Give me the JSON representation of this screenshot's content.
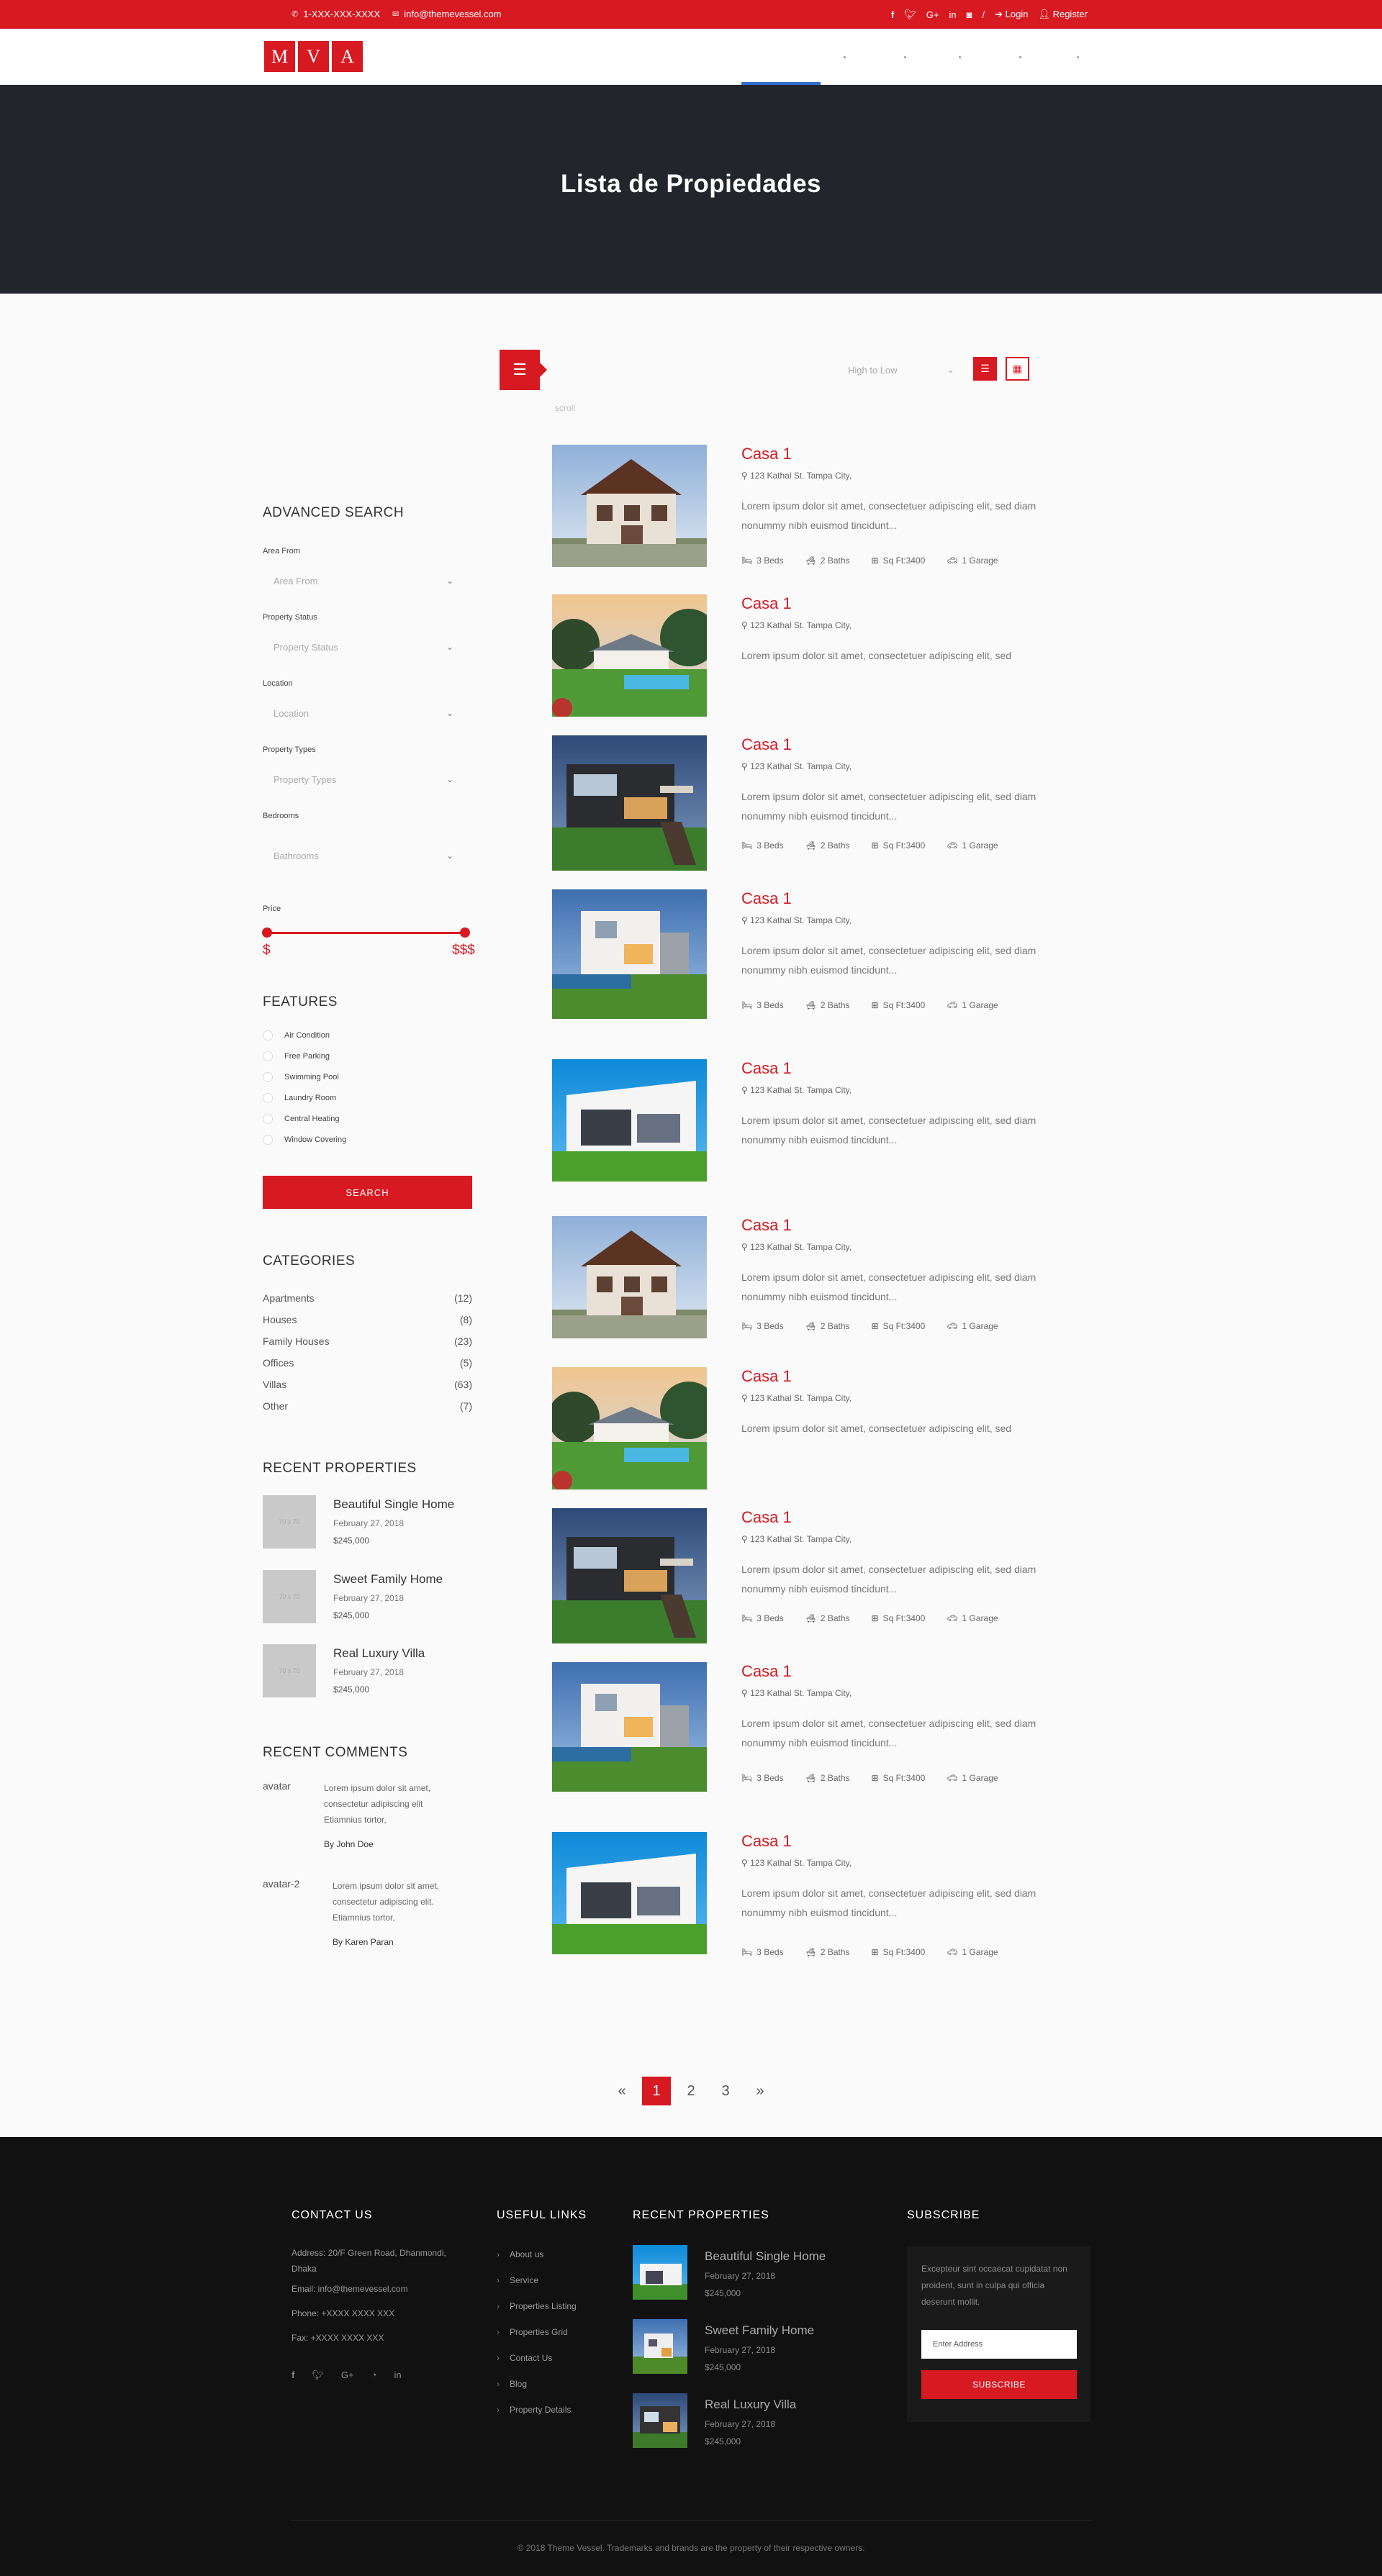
{
  "topbar": {
    "phone": "1-XXX-XXX-XXXX",
    "email": "info@themevessel.com",
    "social_icons": [
      "facebook-icon",
      "twitter-icon",
      "google-plus-icon",
      "linkedin-icon",
      "instagram-icon"
    ],
    "separator": "/",
    "login": "Login",
    "register": "Register"
  },
  "header": {
    "logo_letters": [
      "M",
      "V",
      "A"
    ]
  },
  "banner": {
    "title": "Lista de Propiedades"
  },
  "toolbar": {
    "sort_value": "High to Low",
    "scroll_hint": "scroll"
  },
  "sidebar": {
    "advanced_search_title": "ADVANCED SEARCH",
    "fields": [
      {
        "label": "Area From",
        "placeholder": "Area From"
      },
      {
        "label": "Property Status",
        "placeholder": "Property Status"
      },
      {
        "label": "Location",
        "placeholder": "Location"
      },
      {
        "label": "Property Types",
        "placeholder": "Property Types"
      },
      {
        "label": "Bedrooms",
        "placeholder": "Bathrooms"
      }
    ],
    "price_label": "Price",
    "price_min": "$",
    "price_max": "$$$",
    "features_title": "FEATURES",
    "features": [
      "Air Condition",
      "Free Parking",
      "Swimming Pool",
      "Laundry Room",
      "Central Heating",
      "Window Covering"
    ],
    "search_button": "SEARCH",
    "categories_title": "CATEGORIES",
    "categories": [
      {
        "name": "Apartments",
        "count": "(12)"
      },
      {
        "name": "Houses",
        "count": "(8)"
      },
      {
        "name": "Family Houses",
        "count": "(23)"
      },
      {
        "name": "Offices",
        "count": "(5)"
      },
      {
        "name": "Villas",
        "count": "(63)"
      },
      {
        "name": "Other",
        "count": "(7)"
      }
    ],
    "recent_title": "RECENT PROPERTIES",
    "recent": [
      {
        "thumb": "70 x 70",
        "title": "Beautiful Single Home",
        "date": "February 27, 2018",
        "price": "$245,000"
      },
      {
        "thumb": "70 x 70",
        "title": "Sweet Family Home",
        "date": "February 27, 2018",
        "price": "$245,000"
      },
      {
        "thumb": "70 x 70",
        "title": "Real Luxury Villa",
        "date": "February 27, 2018",
        "price": "$245,000"
      }
    ],
    "comments_title": "RECENT COMMENTS",
    "comments": [
      {
        "avatar_alt": "avatar",
        "text": "Lorem ipsum dolor sit amet, consectetur adipiscing elit Etiamnius tortor,",
        "by": "By John Doe"
      },
      {
        "avatar_alt": "avatar-2",
        "text": "Lorem ipsum dolor sit amet, consectetur adipiscing elit. Etiamnius tortor,",
        "by": "By Karen Paran"
      }
    ]
  },
  "properties": [
    {
      "title": "Casa 1",
      "address": "123 Kathal St. Tampa City,",
      "desc": "Lorem ipsum dolor sit amet, consectetuer adipiscing elit, sed diam nonummy nibh euismod tincidunt...",
      "beds": "3 Beds",
      "baths": "2 Baths",
      "sqft": "Sq Ft:3400",
      "garage": "1 Garage"
    },
    {
      "title": "Casa 1",
      "address": "123 Kathal St. Tampa City,",
      "desc": "Lorem ipsum dolor sit amet, consectetuer adipiscing elit, sed"
    },
    {
      "title": "Casa 1",
      "address": "123 Kathal St. Tampa City,",
      "desc": "Lorem ipsum dolor sit amet, consectetuer adipiscing elit, sed diam nonummy nibh euismod tincidunt...",
      "beds": "3 Beds",
      "baths": "2 Baths",
      "sqft": "Sq Ft:3400",
      "garage": "1 Garage"
    },
    {
      "title": "Casa 1",
      "address": "123 Kathal St. Tampa City,",
      "desc": "Lorem ipsum dolor sit amet, consectetuer adipiscing elit, sed diam nonummy nibh euismod tincidunt...",
      "beds": "3 Beds",
      "baths": "2 Baths",
      "sqft": "Sq Ft:3400",
      "garage": "1 Garage"
    },
    {
      "title": "Casa 1",
      "address": "123 Kathal St. Tampa City,",
      "desc": "Lorem ipsum dolor sit amet, consectetuer adipiscing elit, sed diam nonummy nibh euismod tincidunt..."
    },
    {
      "title": "Casa 1",
      "address": "123 Kathal St. Tampa City,",
      "desc": "Lorem ipsum dolor sit amet, consectetuer adipiscing elit, sed diam nonummy nibh euismod tincidunt...",
      "beds": "3 Beds",
      "baths": "2 Baths",
      "sqft": "Sq Ft:3400",
      "garage": "1 Garage"
    },
    {
      "title": "Casa 1",
      "address": "123 Kathal St. Tampa City,",
      "desc": "Lorem ipsum dolor sit amet, consectetuer adipiscing elit, sed"
    },
    {
      "title": "Casa 1",
      "address": "123 Kathal St. Tampa City,",
      "desc": "Lorem ipsum dolor sit amet, consectetuer adipiscing elit, sed diam nonummy nibh euismod tincidunt...",
      "beds": "3 Beds",
      "baths": "2 Baths",
      "sqft": "Sq Ft:3400",
      "garage": "1 Garage"
    },
    {
      "title": "Casa 1",
      "address": "123 Kathal St. Tampa City,",
      "desc": "Lorem ipsum dolor sit amet, consectetuer adipiscing elit, sed diam nonummy nibh euismod tincidunt...",
      "beds": "3 Beds",
      "baths": "2 Baths",
      "sqft": "Sq Ft:3400",
      "garage": "1 Garage"
    },
    {
      "title": "Casa 1",
      "address": "123 Kathal St. Tampa City,",
      "desc": "Lorem ipsum dolor sit amet, consectetuer adipiscing elit, sed diam nonummy nibh euismod tincidunt...",
      "beds": "3 Beds",
      "baths": "2 Baths",
      "sqft": "Sq Ft:3400",
      "garage": "1 Garage"
    }
  ],
  "pagination": {
    "prev": "«",
    "pages": [
      "1",
      "2",
      "3"
    ],
    "next": "»"
  },
  "footer": {
    "contact_title": "CONTACT US",
    "address": "Address: 20/F Green Road, Dhanmondi, Dhaka",
    "email": "Email: info@themevessel.com",
    "phone": "Phone: +XXXX XXXX XXX",
    "fax": "Fax: +XXXX XXXX XXX",
    "social_icons": [
      "facebook-icon",
      "twitter-icon",
      "google-plus-icon",
      "rss-icon",
      "linkedin-icon"
    ],
    "links_title": "USEFUL LINKS",
    "links": [
      "About us",
      "Service",
      "Properties Listing",
      "Properties Grid",
      "Contact Us",
      "Blog",
      "Property Details"
    ],
    "recent_title": "RECENT PROPERTIES",
    "recent": [
      {
        "title": "Beautiful Single Home",
        "date": "February 27, 2018",
        "price": "$245,000"
      },
      {
        "title": "Sweet Family Home",
        "date": "February 27, 2018",
        "price": "$245,000"
      },
      {
        "title": "Real Luxury Villa",
        "date": "February 27, 2018",
        "price": "$245,000"
      }
    ],
    "subscribe_title": "SUBSCRIBE",
    "subscribe_text": "Excepteur sint occaecat cupidatat non proident, sunt in culpa qui officia deserunt mollit.",
    "email_placeholder": "Enter Address",
    "subscribe_button": "SUBSCRIBE",
    "copyright": "© 2018 Theme Vessel. Trademarks and brands are the property of their respective owners."
  }
}
